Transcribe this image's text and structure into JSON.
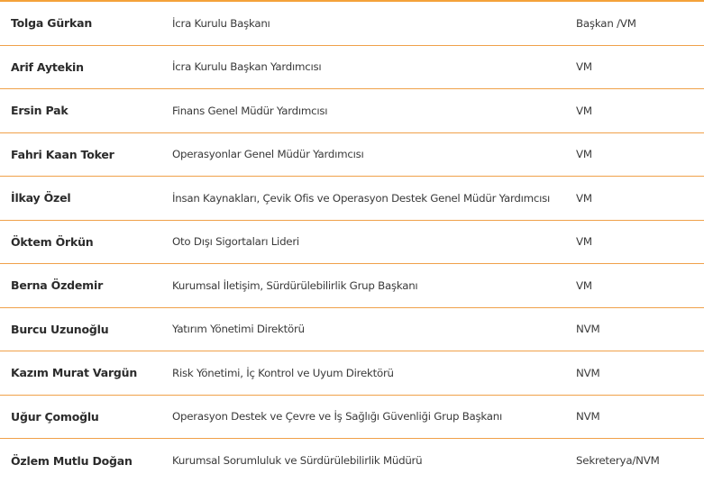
{
  "table": {
    "rows": [
      {
        "name": "Tolga Gürkan",
        "role": "İcra Kurulu Başkanı",
        "status": "Başkan /VM"
      },
      {
        "name": "Arif Aytekin",
        "role": "İcra Kurulu Başkan Yardımcısı",
        "status": "VM"
      },
      {
        "name": "Ersin Pak",
        "role": "Finans Genel Müdür Yardımcısı",
        "status": "VM"
      },
      {
        "name": "Fahri Kaan Toker",
        "role": "Operasyonlar Genel Müdür Yardımcısı",
        "status": "VM"
      },
      {
        "name": "İlkay Özel",
        "role": "İnsan Kaynakları, Çevik Ofis ve Operasyon Destek Genel Müdür Yardımcısı",
        "status": "VM"
      },
      {
        "name": "Öktem Örkün",
        "role": "Oto Dışı Sigortaları Lideri",
        "status": "VM"
      },
      {
        "name": "Berna Özdemir",
        "role": "Kurumsal İletişim, Sürdürülebilirlik Grup Başkanı",
        "status": "VM"
      },
      {
        "name": "Burcu Uzunoğlu",
        "role": "Yatırım Yönetimi Direktörü",
        "status": "NVM"
      },
      {
        "name": "Kazım Murat Vargün",
        "role": "Risk Yönetimi, İç Kontrol ve Uyum Direktörü",
        "status": "NVM"
      },
      {
        "name": "Uğur Çomoğlu",
        "role": "Operasyon Destek ve Çevre ve İş Sağlığı Güvenliği Grup Başkanı",
        "status": "NVM"
      },
      {
        "name": "Özlem Mutlu Doğan",
        "role": "Kurumsal Sorumluluk ve Sürdürülebilirlik Müdürü",
        "status": "Sekreterya/NVM"
      }
    ]
  },
  "colors": {
    "rule": "#f0a14a",
    "text": "#333333"
  }
}
